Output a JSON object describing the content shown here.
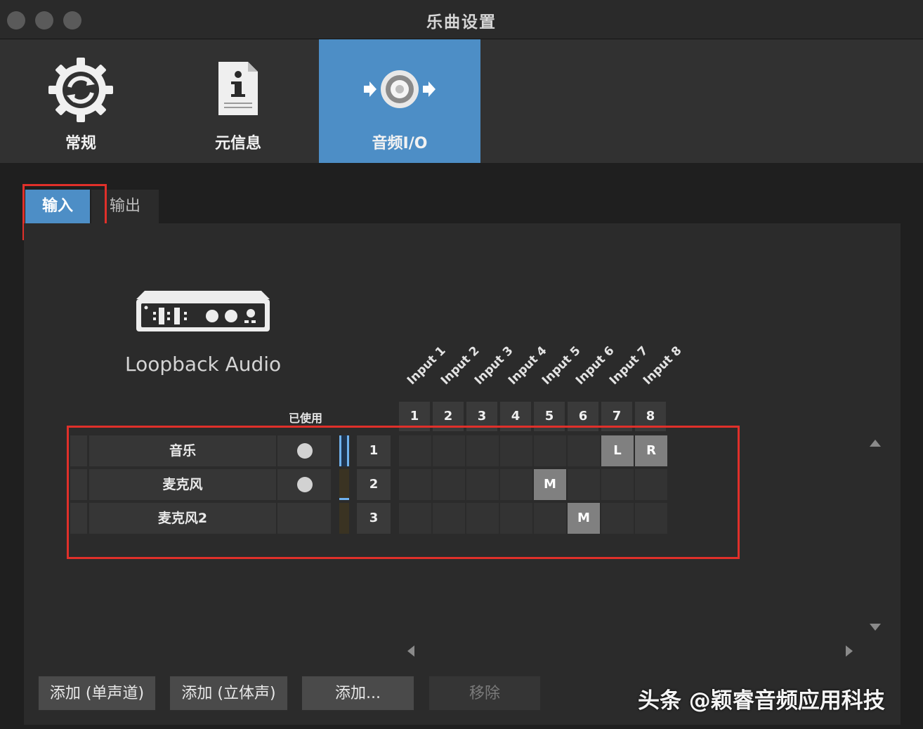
{
  "window": {
    "title": "乐曲设置"
  },
  "toolbar": {
    "items": [
      {
        "label": "常规",
        "icon": "gear-sync-icon"
      },
      {
        "label": "元信息",
        "icon": "info-document-icon"
      },
      {
        "label": "音频I/O",
        "icon": "speaker-io-icon",
        "active": true
      }
    ]
  },
  "tabs": {
    "input": "输入",
    "output": "输出",
    "selected": "输入"
  },
  "device": {
    "name": "Loopback Audio"
  },
  "matrix": {
    "input_labels": [
      "Input 1",
      "Input 2",
      "Input 3",
      "Input 4",
      "Input 5",
      "Input 6",
      "Input 7",
      "Input 8"
    ],
    "column_numbers": [
      "1",
      "2",
      "3",
      "4",
      "5",
      "6",
      "7",
      "8"
    ],
    "used_header": "已使用",
    "rows": [
      {
        "name": "音乐",
        "used": true,
        "number": "1",
        "assignments": {
          "7": "L",
          "8": "R"
        }
      },
      {
        "name": "麦克风",
        "used": true,
        "number": "2",
        "assignments": {
          "5": "M"
        }
      },
      {
        "name": "麦克风2",
        "used": false,
        "number": "3",
        "assignments": {
          "6": "M"
        }
      }
    ]
  },
  "buttons": {
    "add_mono": "添加 (单声道)",
    "add_stereo": "添加 (立体声)",
    "add_more": "添加...",
    "remove": "移除"
  },
  "watermark": "头条 @颖睿音频应用科技",
  "colors": {
    "accent": "#4d8ec6",
    "highlight_box": "#e0302a",
    "background": "#1f1f1f"
  }
}
